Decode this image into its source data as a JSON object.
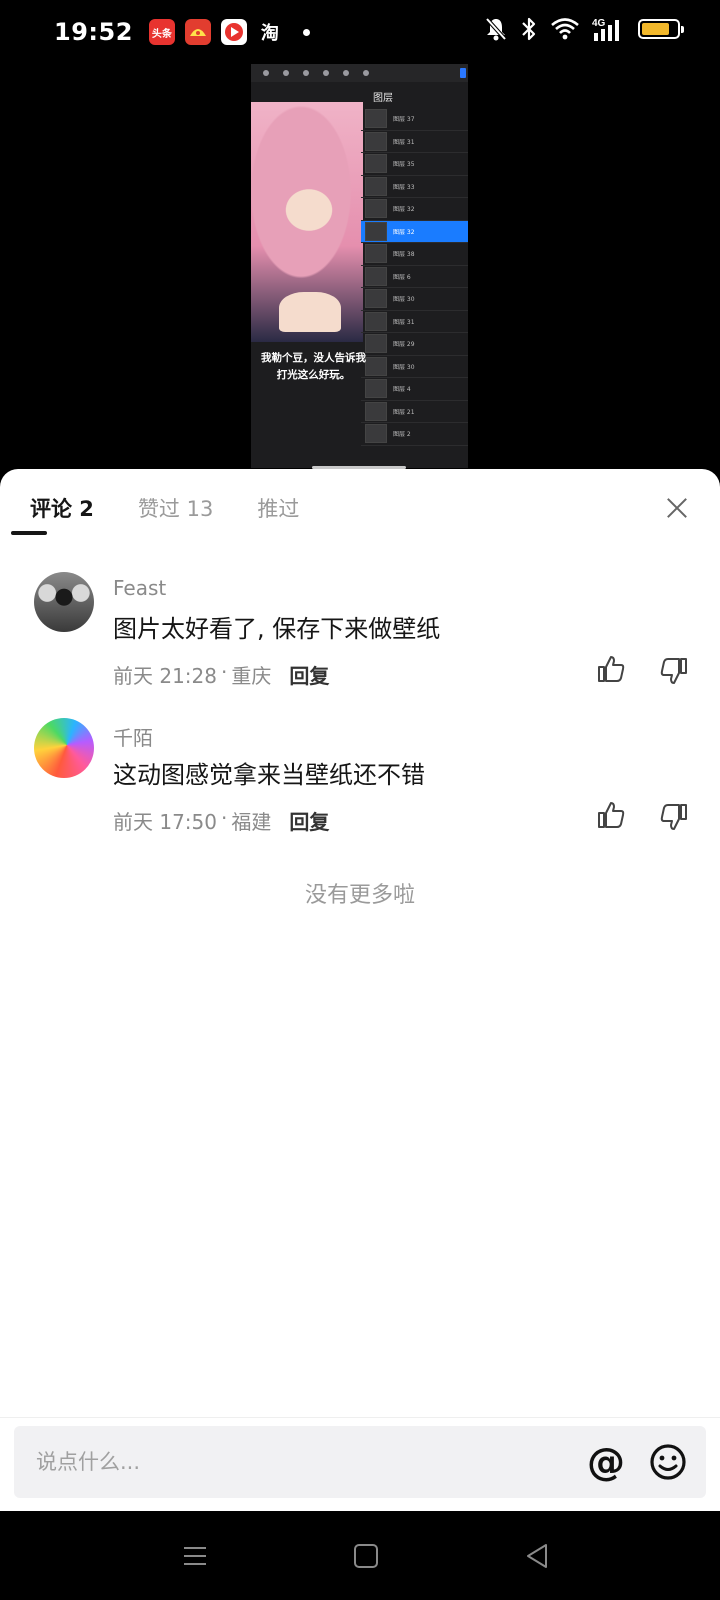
{
  "status_bar": {
    "time": "19:52",
    "app_icons": [
      {
        "name": "toutiao-app-icon",
        "label": "头条",
        "color": "#e8332f"
      },
      {
        "name": "red-app-icon",
        "label": "",
        "color": "#e23d2f"
      },
      {
        "name": "circle-app-icon",
        "label": "",
        "color": "#ffffff"
      },
      {
        "name": "taobao-app-icon",
        "label": "淘",
        "color": "#ffffff"
      }
    ],
    "network": "4G",
    "battery_level": 0.8,
    "battery_color": "#f2b82b"
  },
  "media": {
    "layers_title": "图层",
    "layers": [
      "图层 37",
      "图层 31",
      "图层 35",
      "图层 33",
      "图层 32",
      "图层 32",
      "图层 38",
      "图层 6",
      "图层 30",
      "图层 31",
      "图层 29",
      "图层 30",
      "图层 4",
      "图层 21",
      "图层 2"
    ],
    "active_layer_index": 5,
    "caption_line1": "我勒个豆，没人告诉我",
    "caption_line2": "打光这么好玩。",
    "accent": "#1a7cff"
  },
  "sheet": {
    "tabs": [
      {
        "label": "评论 2",
        "active": true
      },
      {
        "label": "赞过 13",
        "active": false
      },
      {
        "label": "推过",
        "active": false
      }
    ],
    "comments": [
      {
        "user": "Feast",
        "text": "图片太好看了, 保存下来做壁纸",
        "time": "前天 21:28",
        "location": "重庆",
        "reply_label": "回复"
      },
      {
        "user": "千陌",
        "text": "这动图感觉拿来当壁纸还不错",
        "time": "前天 17:50",
        "location": "福建",
        "reply_label": "回复"
      }
    ],
    "meta_separator": "·",
    "no_more_text": "没有更多啦"
  },
  "input_bar": {
    "placeholder": "说点什么...",
    "at_symbol": "@"
  }
}
